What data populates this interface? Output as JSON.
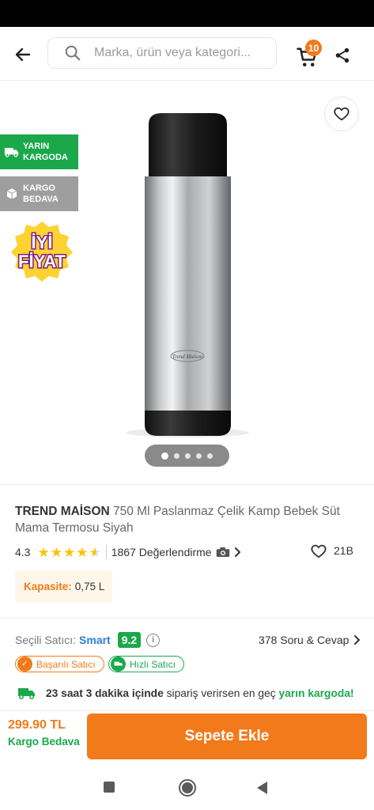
{
  "search": {
    "placeholder": "Marka, ürün veya kategori..."
  },
  "header": {
    "cart_count": "10"
  },
  "gallery": {
    "badges": [
      {
        "label_line1": "YARIN",
        "label_line2": "KARGODA",
        "color": "#1aa84a"
      },
      {
        "label_line1": "KARGO",
        "label_line2": "BEDAVA",
        "color": "#9e9e9e"
      }
    ],
    "promo_line1": "İYİ",
    "promo_line2": "FİYAT",
    "product_logo_text": "Trend Maison",
    "image_count": 5,
    "active_index": 0
  },
  "product": {
    "brand": "TREND MAİSON",
    "name": "750 Ml Paslanmaz Çelik Kamp Bebek Süt Mama Termosu Siyah",
    "rating": "4.3",
    "rating_value": 4.3,
    "review_text": "1867 Değerlendirme",
    "favorites": "21B",
    "attribute_label": "Kapasite:",
    "attribute_value": "0,75 L"
  },
  "seller": {
    "label": "Seçili Satıcı:",
    "name": "Smart",
    "score": "9.2",
    "qa": "378 Soru & Cevap",
    "badge_success": "Başarılı Satıcı",
    "badge_fast": "Hızlı Satıcı"
  },
  "delivery": {
    "time": "23 saat 3 dakika içinde",
    "middle": "sipariş verirsen en geç",
    "target": "yarın kargoda!"
  },
  "footer": {
    "price": "299.90 TL",
    "shipping": "Kargo Bedava",
    "add_to_cart": "Sepete Ekle"
  },
  "colors": {
    "accent": "#f27a1a",
    "green": "#1aa84a",
    "link": "#2d7ed8"
  }
}
